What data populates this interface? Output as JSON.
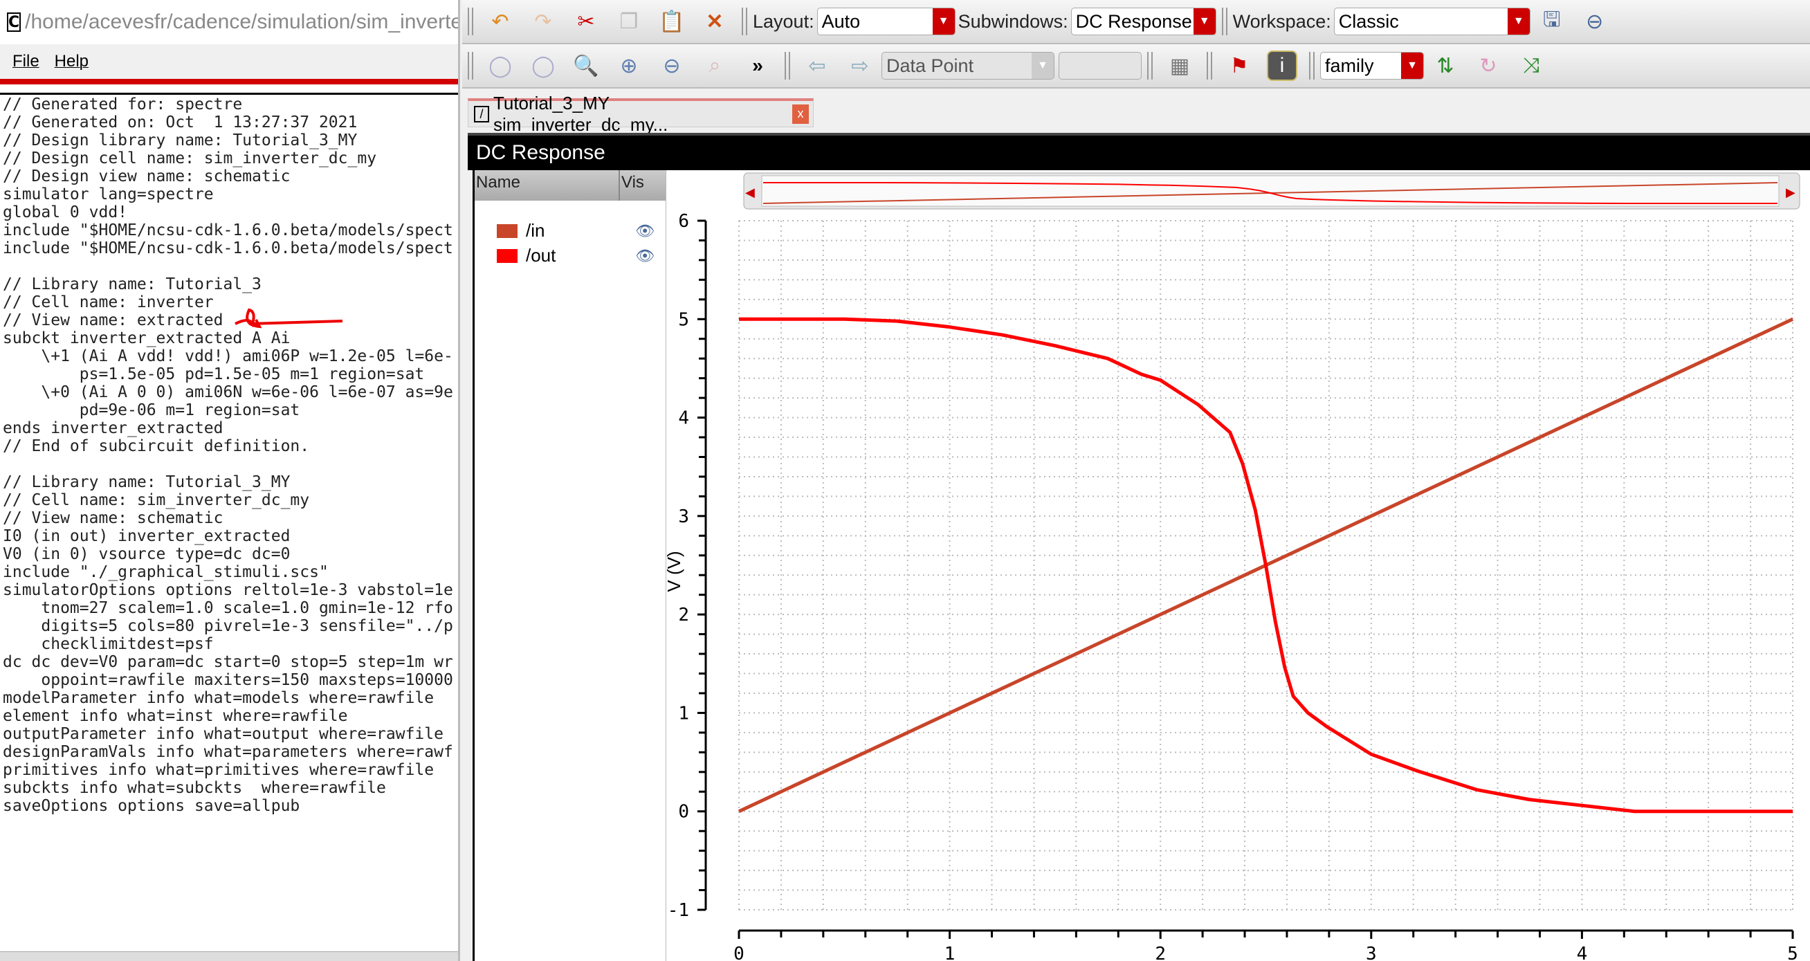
{
  "left_window": {
    "title": "/home/acevesfr/cadence/simulation/sim_inverter_dc_my/s",
    "menu": [
      "File",
      "Help"
    ],
    "lines": [
      "// Generated for: spectre",
      "// Generated on: Oct  1 13:27:37 2021",
      "// Design library name: Tutorial_3_MY",
      "// Design cell name: sim_inverter_dc_my",
      "// Design view name: schematic",
      "simulator lang=spectre",
      "global 0 vdd!",
      "include \"$HOME/ncsu-cdk-1.6.0.beta/models/spect",
      "include \"$HOME/ncsu-cdk-1.6.0.beta/models/spect",
      "",
      "// Library name: Tutorial_3",
      "// Cell name: inverter",
      "// View name: extracted",
      "subckt inverter_extracted A Ai",
      "    \\+1 (Ai A vdd! vdd!) ami06P w=1.2e-05 l=6e-",
      "        ps=1.5e-05 pd=1.5e-05 m=1 region=sat",
      "    \\+0 (Ai A 0 0) ami06N w=6e-06 l=6e-07 as=9e",
      "        pd=9e-06 m=1 region=sat",
      "ends inverter_extracted",
      "// End of subcircuit definition.",
      "",
      "// Library name: Tutorial_3_MY",
      "// Cell name: sim_inverter_dc_my",
      "// View name: schematic",
      "I0 (in out) inverter_extracted",
      "V0 (in 0) vsource type=dc dc=0",
      "include \"./_graphical_stimuli.scs\"",
      "simulatorOptions options reltol=1e-3 vabstol=1e",
      "    tnom=27 scalem=1.0 scale=1.0 gmin=1e-12 rfo",
      "    digits=5 cols=80 pivrel=1e-3 sensfile=\"../p",
      "    checklimitdest=psf",
      "dc dc dev=V0 param=dc start=0 stop=5 step=1m wr",
      "    oppoint=rawfile maxiters=150 maxsteps=10000",
      "modelParameter info what=models where=rawfile",
      "element info what=inst where=rawfile",
      "outputParameter info what=output where=rawfile",
      "designParamVals info what=parameters where=rawf",
      "primitives info what=primitives where=rawfile",
      "subckts info what=subckts  where=rawfile",
      "saveOptions options save=allpub"
    ]
  },
  "toolbar": {
    "layout_label": "Layout:",
    "layout_value": "Auto",
    "subwindows_label": "Subwindows:",
    "subwindows_value": "DC Response",
    "workspace_label": "Workspace:",
    "workspace_value": "Classic",
    "marker_value": "Data Point",
    "marker_input": "",
    "family_value": "family",
    "more": "»"
  },
  "tab": {
    "label": "Tutorial_3_MY sim_inverter_dc_my...",
    "close": "x"
  },
  "subwindow": {
    "title": "DC Response"
  },
  "trace_panel": {
    "headers": [
      "Name",
      "Vis"
    ],
    "traces": [
      {
        "name": "/in",
        "color": "#c8452a"
      },
      {
        "name": "/out",
        "color": "#ff0000"
      }
    ]
  },
  "chart_data": {
    "type": "line",
    "ylabel": "V (V)",
    "xlim": [
      0,
      5
    ],
    "ylim": [
      -1,
      6
    ],
    "xticks": [
      "0",
      "1",
      "2",
      "3",
      "4",
      "5"
    ],
    "yticks": [
      "-1",
      "0",
      "1",
      "2",
      "3",
      "4",
      "5",
      "6"
    ],
    "grid": true,
    "series": [
      {
        "name": "/in",
        "color": "#c8452a",
        "x": [
          0,
          5
        ],
        "y": [
          0,
          5
        ]
      },
      {
        "name": "/out",
        "color": "#ff0000",
        "x": [
          0,
          0.5,
          0.75,
          1,
          1.25,
          1.5,
          1.75,
          1.91,
          2.0,
          2.18,
          2.33,
          2.39,
          2.45,
          2.5,
          2.545,
          2.59,
          2.63,
          2.7,
          2.79,
          3.0,
          3.22,
          3.5,
          3.75,
          4.0,
          4.25,
          5.0
        ],
        "y": [
          5,
          5,
          4.98,
          4.92,
          4.84,
          4.73,
          4.6,
          4.44,
          4.38,
          4.13,
          3.85,
          3.53,
          3.06,
          2.5,
          1.93,
          1.46,
          1.17,
          1.0,
          0.86,
          0.58,
          0.41,
          0.22,
          0.12,
          0.06,
          0,
          0
        ]
      }
    ]
  }
}
